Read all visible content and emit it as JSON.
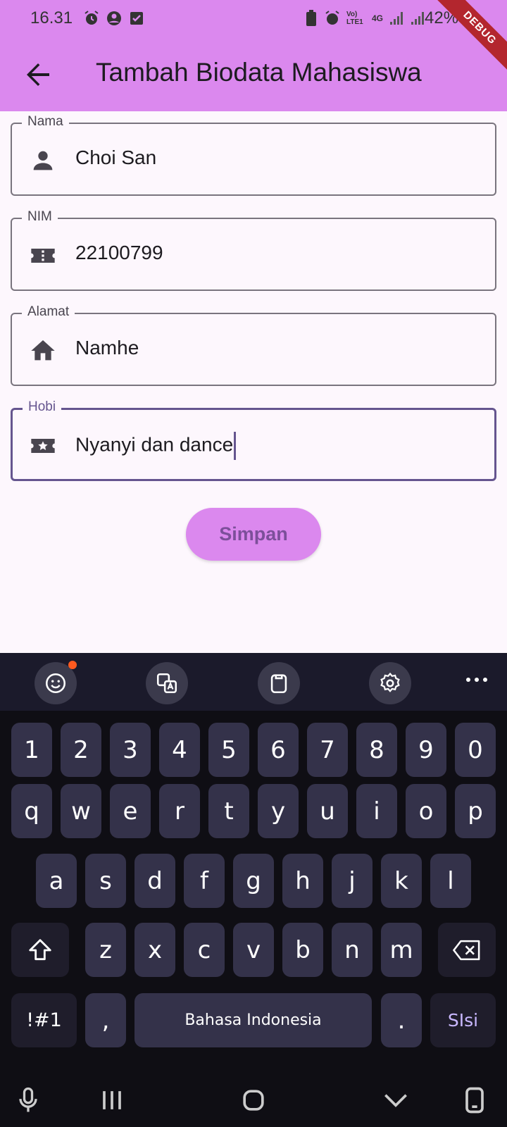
{
  "status_bar": {
    "time": "16.31",
    "battery": "42%",
    "network_label_1": "Vo) LTE1",
    "network_label_2": "4G"
  },
  "debug_banner": "DEBUG",
  "app_bar": {
    "title": "Tambah Biodata Mahasiswa"
  },
  "form": {
    "fields": [
      {
        "label": "Nama",
        "value": "Choi San",
        "icon": "person-icon"
      },
      {
        "label": "NIM",
        "value": "22100799",
        "icon": "ticket-icon"
      },
      {
        "label": "Alamat",
        "value": "Namhe",
        "icon": "home-icon"
      },
      {
        "label": "Hobi",
        "value": "Nyanyi dan dance",
        "icon": "star-ticket-icon"
      }
    ],
    "save_label": "Simpan"
  },
  "keyboard": {
    "row_numbers": [
      "1",
      "2",
      "3",
      "4",
      "5",
      "6",
      "7",
      "8",
      "9",
      "0"
    ],
    "row_1": [
      "q",
      "w",
      "e",
      "r",
      "t",
      "y",
      "u",
      "i",
      "o",
      "p"
    ],
    "row_2": [
      "a",
      "s",
      "d",
      "f",
      "g",
      "h",
      "j",
      "k",
      "l"
    ],
    "row_3": [
      "z",
      "x",
      "c",
      "v",
      "b",
      "n",
      "m"
    ],
    "symbols_label": "!#1",
    "comma_label": ",",
    "space_label": "Bahasa Indonesia",
    "period_label": ".",
    "action_label": "SIsi"
  },
  "colors": {
    "app_bar": "#DB88EE",
    "focus": "#65558F",
    "keyboard_bg": "#0F0E14",
    "key": "#34324A"
  }
}
